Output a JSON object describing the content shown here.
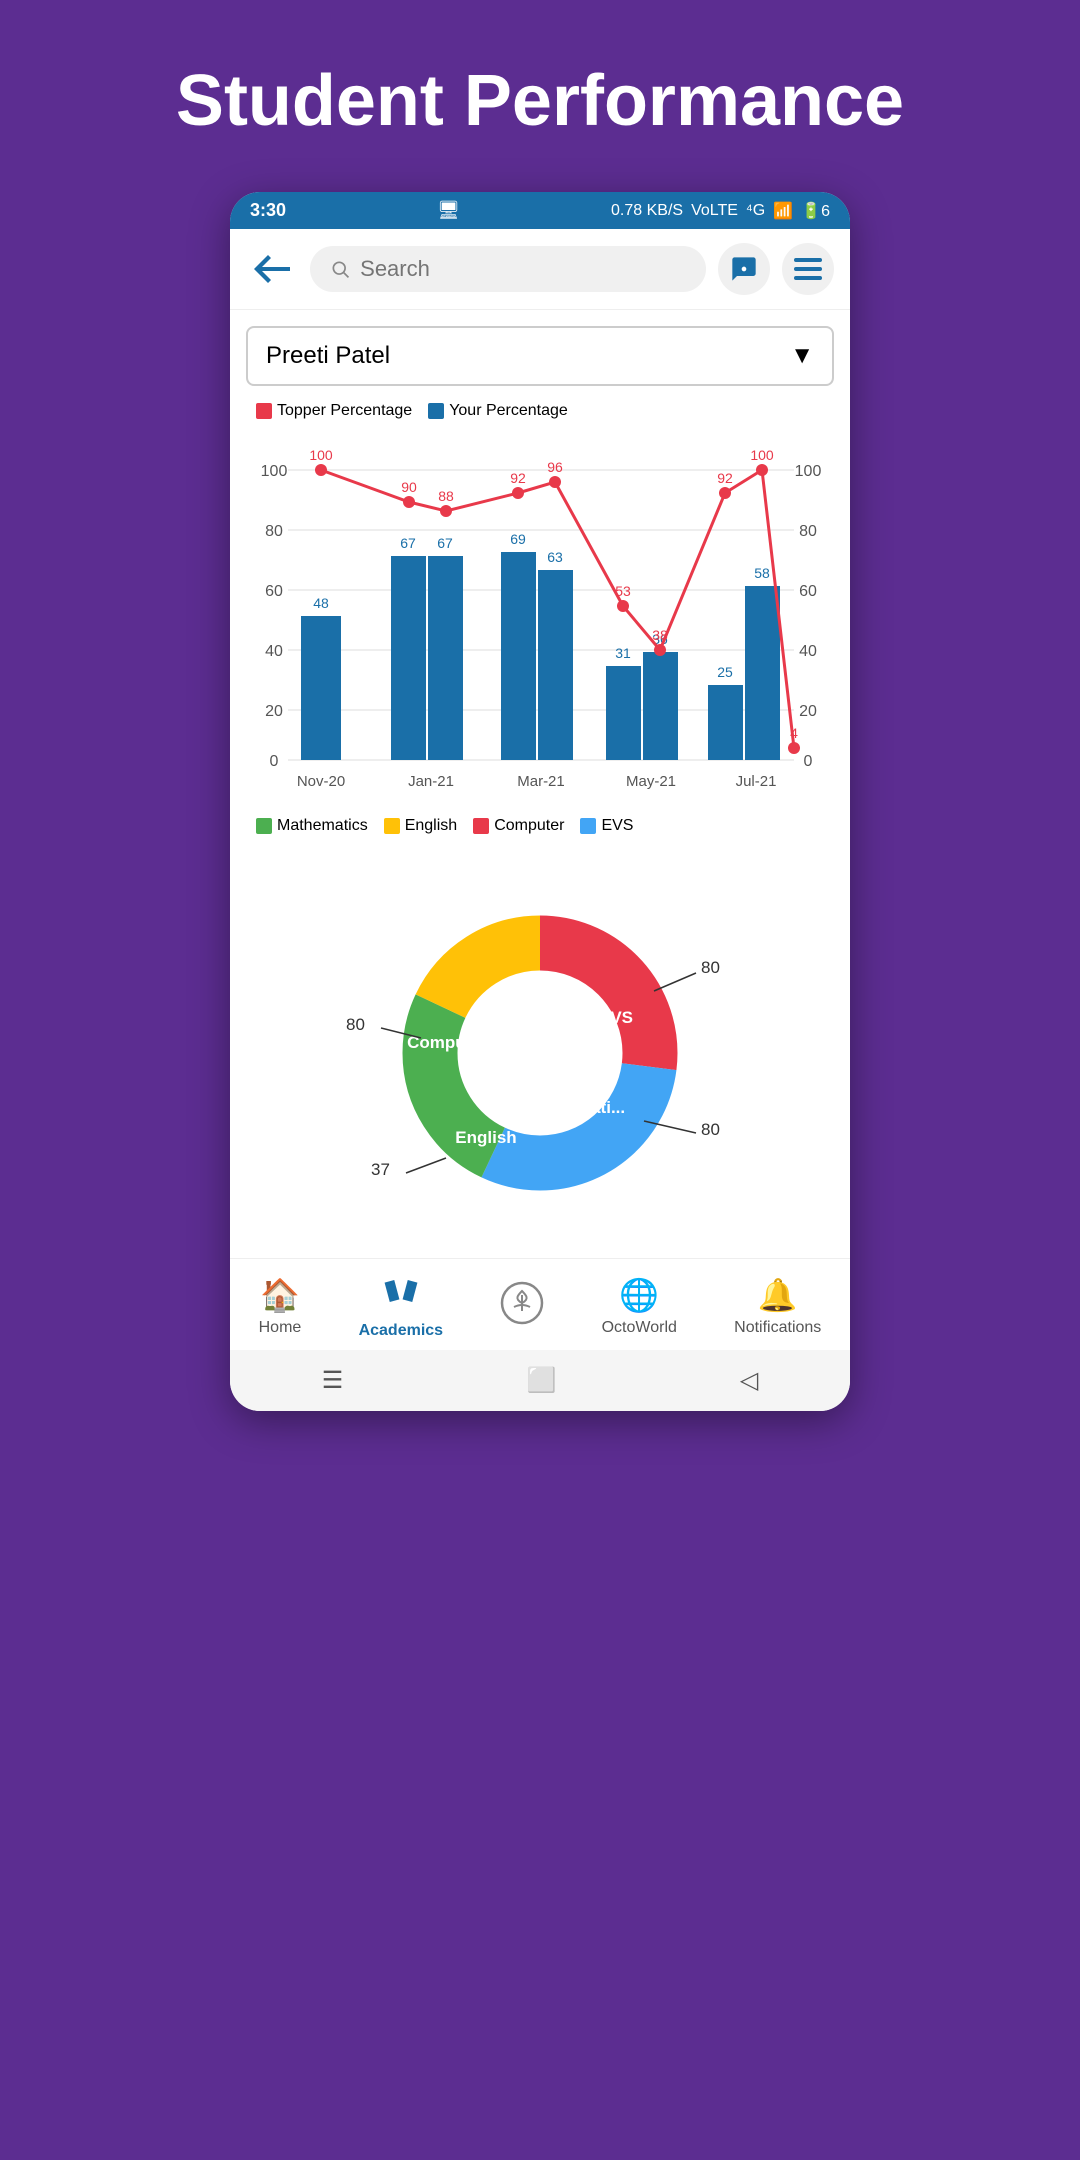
{
  "page": {
    "title": "Student Performance",
    "background_color": "#5c2d91"
  },
  "status_bar": {
    "time": "3:30",
    "network_speed": "0.78 KB/S",
    "voip": "VoLTE",
    "signal": "4G",
    "battery": "6"
  },
  "toolbar": {
    "search_placeholder": "Search",
    "back_label": "back",
    "chat_label": "chat",
    "menu_label": "menu"
  },
  "student_selector": {
    "value": "Preeti Patel"
  },
  "bar_chart": {
    "legend": [
      {
        "label": "Topper Percentage",
        "color": "#e8394a"
      },
      {
        "label": "Your Percentage",
        "color": "#1a6fa8"
      }
    ],
    "months": [
      "Nov-20",
      "Jan-21",
      "Mar-21",
      "May-21",
      "Jul-21"
    ],
    "bars": [
      {
        "month": "Nov-20",
        "value": 48
      },
      {
        "month": "Jan-21",
        "value": 67
      },
      {
        "month": "Jan-21b",
        "value": 67
      },
      {
        "month": "Mar-21",
        "value": 69
      },
      {
        "month": "Mar-21b",
        "value": 63
      },
      {
        "month": "May-21",
        "value": 31
      },
      {
        "month": "May-21b",
        "value": 36
      },
      {
        "month": "Jul-21",
        "value": 25
      },
      {
        "month": "Jul-21b",
        "value": 58
      }
    ],
    "line_points": [
      {
        "month": "Nov-20",
        "value": 100
      },
      {
        "month": "Jan-21",
        "value": 90
      },
      {
        "month": "Jan-21b",
        "value": 88
      },
      {
        "month": "Mar-21",
        "value": 92
      },
      {
        "month": "Mar-21b",
        "value": 96
      },
      {
        "month": "May-21",
        "value": 53
      },
      {
        "month": "May-21b",
        "value": 38
      },
      {
        "month": "Jul-21",
        "value": 92
      },
      {
        "month": "Jul-21b",
        "value": 100
      },
      {
        "month": "end",
        "value": 4
      }
    ],
    "subject_legend": [
      {
        "label": "Mathematics",
        "color": "#4caf50"
      },
      {
        "label": "English",
        "color": "#ffc107"
      },
      {
        "label": "Computer",
        "color": "#e8394a"
      },
      {
        "label": "EVS",
        "color": "#42a5f5"
      }
    ]
  },
  "donut_chart": {
    "segments": [
      {
        "label": "EVS",
        "value": 80,
        "color": "#42a5f5",
        "percent": 30
      },
      {
        "label": "Mathematics",
        "value": 80,
        "color": "#4caf50",
        "percent": 25
      },
      {
        "label": "English",
        "value": 37,
        "color": "#ffc107",
        "percent": 18
      },
      {
        "label": "Computer",
        "value": 80,
        "color": "#e8394a",
        "percent": 27
      }
    ],
    "annotations": [
      {
        "label": "80",
        "side": "right"
      },
      {
        "label": "80",
        "side": "right"
      },
      {
        "label": "37",
        "side": "left"
      },
      {
        "label": "80",
        "side": "left"
      }
    ]
  },
  "bottom_nav": {
    "items": [
      {
        "label": "Home",
        "icon": "🏠",
        "active": false
      },
      {
        "label": "Academics",
        "icon": "✏️",
        "active": true
      },
      {
        "label": "",
        "icon": "🛡️",
        "active": false,
        "center": true
      },
      {
        "label": "OctoWorld",
        "icon": "🌐",
        "active": false
      },
      {
        "label": "Notifications",
        "icon": "🔔",
        "active": false
      }
    ]
  }
}
